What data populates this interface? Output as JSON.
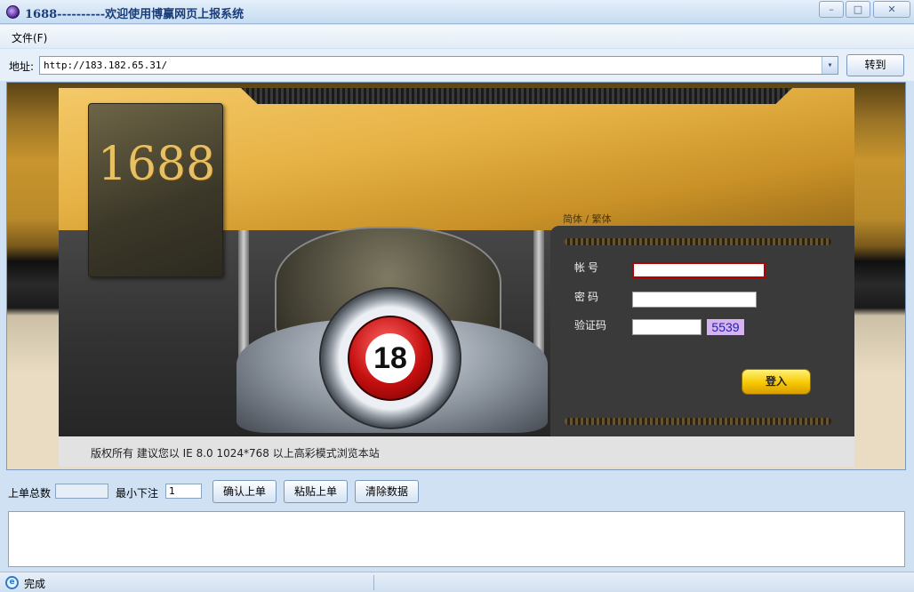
{
  "window": {
    "title": "1688----------欢迎使用博赢网页上报系统",
    "minimize_glyph": "–",
    "maximize_glyph": "□",
    "close_glyph": "✕"
  },
  "menu": {
    "file": "文件(F)"
  },
  "address": {
    "label": "地址:",
    "url": "http://183.182.65.31/",
    "dropdown_glyph": "▾",
    "go_label": "转到"
  },
  "site": {
    "logo_text": "1688",
    "lang_simplified": "简体",
    "lang_sep": " / ",
    "lang_traditional": "繁体",
    "ball_number": "18",
    "account_label": "帐号",
    "password_label": "密码",
    "captcha_label": "验证码",
    "captcha_code": "5539",
    "login_label": "登入",
    "footer": "版权所有 建议您以 IE 8.0 1024*768 以上高彩模式浏览本站"
  },
  "controls": {
    "total_label": "上单总数",
    "total_value": "",
    "min_bet_label": "最小下注",
    "min_bet_value": "1",
    "confirm_label": "确认上单",
    "paste_label": "粘贴上单",
    "clear_label": "清除数据"
  },
  "status": {
    "icon": "e",
    "text": "完成"
  },
  "colors": {
    "accent_gold": "#e7b347",
    "login_button": "#f6c800",
    "window_chrome": "#cfe1f3"
  }
}
